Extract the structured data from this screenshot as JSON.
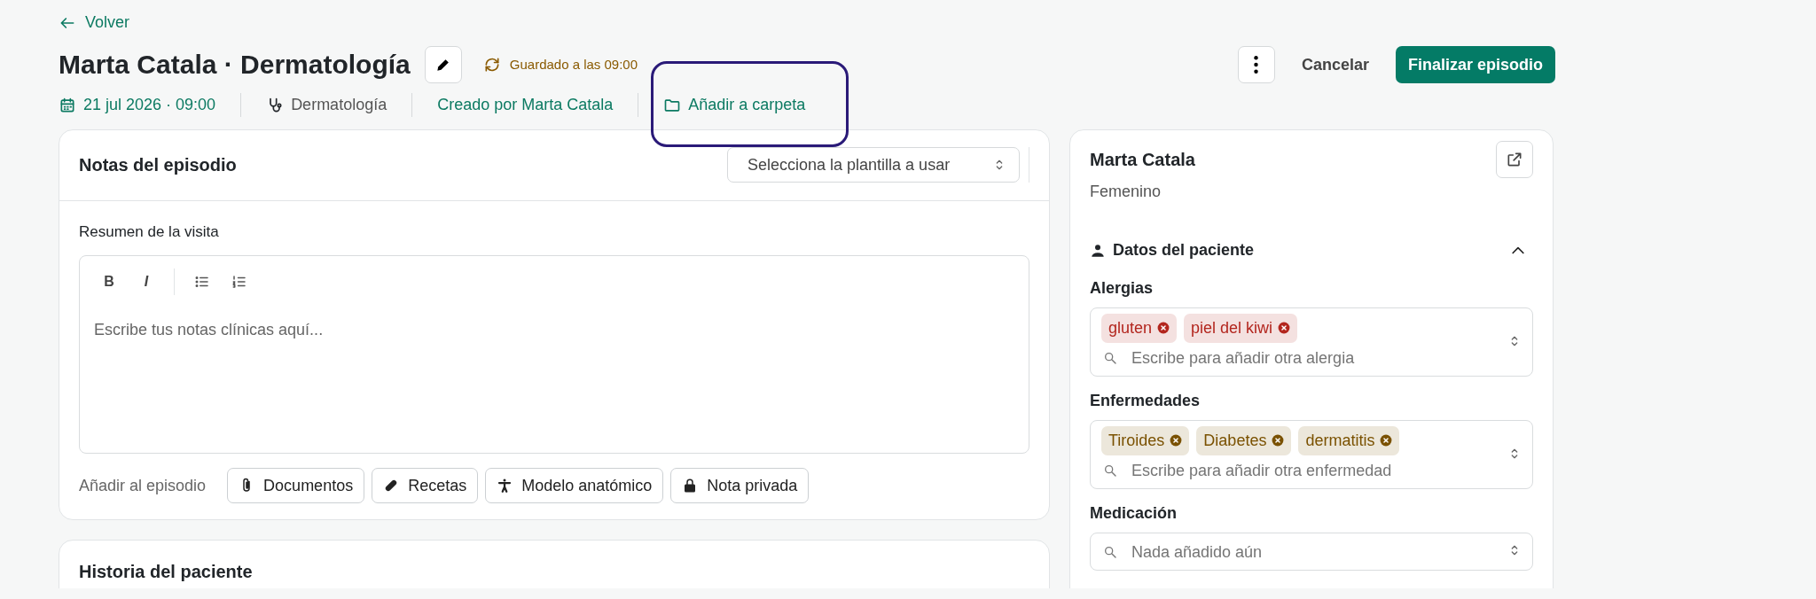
{
  "back_link": {
    "label": "Volver"
  },
  "header": {
    "title": "Marta Catala · Dermatología",
    "save_status": "Guardado a las 09:00",
    "actions": [
      {
        "kind": "more"
      },
      {
        "kind": "link",
        "label": "Cancelar"
      },
      {
        "kind": "primary",
        "label": "Finalizar episodio"
      }
    ]
  },
  "meta": [
    {
      "kind": "date",
      "label": "21 jul 2026 · 09:00"
    },
    {
      "kind": "specialty",
      "label": "Dermatología"
    },
    {
      "kind": "author",
      "label": "Creado por Marta Catala"
    },
    {
      "kind": "folder",
      "label": "Añadir a carpeta",
      "highlighted": true
    }
  ],
  "notes_card": {
    "title": "Notas del episodio",
    "template_select": {
      "placeholder": "Selecciona la plantilla a usar"
    },
    "editor_label": "Resumen de la visita",
    "toolbar": [
      {
        "kind": "bold",
        "label": "B"
      },
      {
        "kind": "italic",
        "label": "I"
      },
      {
        "kind": "bullets"
      },
      {
        "kind": "numbered"
      }
    ],
    "editor_placeholder": "Escribe tus notas clínicas aquí...",
    "add_label": "Añadir al episodio",
    "add_buttons": [
      {
        "kind": "attach",
        "label": "Documentos"
      },
      {
        "kind": "pill",
        "label": "Recetas"
      },
      {
        "kind": "body",
        "label": "Modelo anatómico"
      },
      {
        "kind": "lock",
        "label": "Nota privada"
      }
    ]
  },
  "history_card": {
    "title": "Historia del paciente"
  },
  "patient_card": {
    "name": "Marta Catala",
    "sex": "Femenino",
    "section": {
      "title": "Datos del paciente",
      "expanded": true
    },
    "fields": [
      {
        "label": "Alergias",
        "color": "#b3261e",
        "tags": [
          "gluten",
          "piel del kiwi"
        ],
        "placeholder": "Escribe para añadir otra alergia"
      },
      {
        "label": "Enfermedades",
        "color": "#7a5100",
        "tags": [
          "Tiroides",
          "Diabetes",
          "dermatitis"
        ],
        "placeholder": "Escribe para añadir otra enfermedad"
      },
      {
        "label": "Medicación",
        "placeholder": "Nada añadido aún"
      }
    ]
  }
}
